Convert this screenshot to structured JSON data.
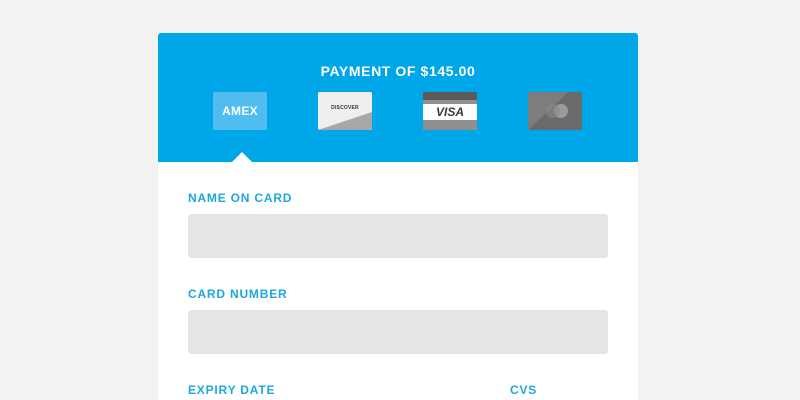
{
  "header": {
    "title": "PAYMENT OF $145.00"
  },
  "card_options": [
    {
      "name": "amex",
      "label": "AMEX",
      "icon": "amex-card-icon",
      "selected": true
    },
    {
      "name": "discover",
      "label": "DISCOVER",
      "icon": "discover-card-icon",
      "selected": false
    },
    {
      "name": "visa",
      "label": "VISA",
      "icon": "visa-card-icon",
      "selected": false
    },
    {
      "name": "mastercard",
      "label": "",
      "icon": "mastercard-card-icon",
      "selected": false
    }
  ],
  "form": {
    "name_on_card": {
      "label": "NAME ON CARD",
      "value": ""
    },
    "card_number": {
      "label": "CARD NUMBER",
      "value": ""
    },
    "expiry_date": {
      "label": "EXPIRY DATE"
    },
    "cvs": {
      "label": "CVS"
    }
  },
  "colors": {
    "accent": "#00a7e8",
    "label": "#1ea7db",
    "input_bg": "#e5e5e5",
    "page_bg": "#f2f2f2"
  }
}
